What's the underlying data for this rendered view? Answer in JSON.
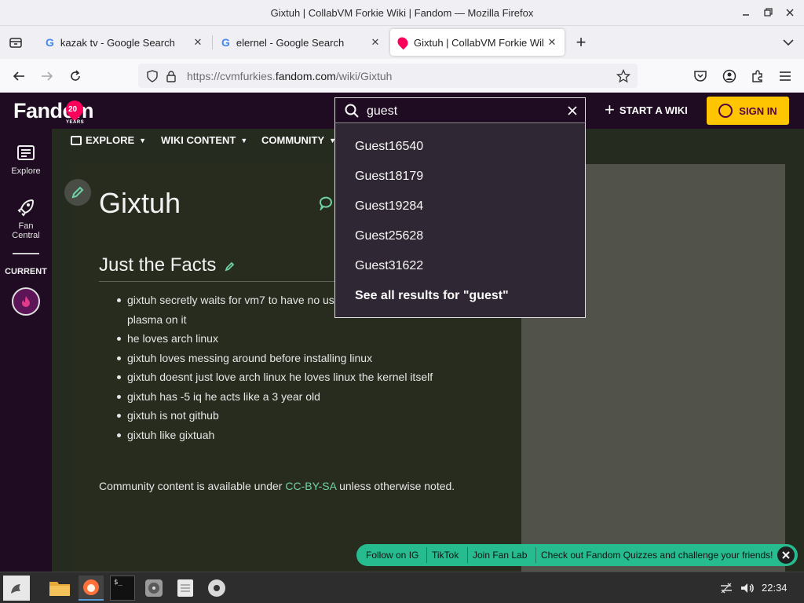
{
  "window": {
    "title": "Gixtuh | CollabVM Forkie Wiki | Fandom — Mozilla Firefox"
  },
  "tabs": [
    {
      "label": "kazak tv - Google Search"
    },
    {
      "label": "elernel - Google Search"
    },
    {
      "label": "Gixtuh | CollabVM Forkie Wiki | Fandom"
    }
  ],
  "url": {
    "prefix": "https://cvmfurkies.",
    "domain": "fandom.com",
    "path": "/wiki/Gixtuh"
  },
  "fandom": {
    "logo": "Fandom",
    "anniversary": "20",
    "years": "YEARS",
    "start_wiki": "START A WIKI",
    "sign_in": "SIGN IN"
  },
  "rail": {
    "explore": "Explore",
    "fan_central_1": "Fan",
    "fan_central_2": "Central",
    "current": "CURRENT"
  },
  "localnav": {
    "explore": "EXPLORE",
    "wiki_content": "WIKI CONTENT",
    "community": "COMMUNITY"
  },
  "search": {
    "query": "guest",
    "results": [
      "Guest16540",
      "Guest18179",
      "Guest19284",
      "Guest25628",
      "Guest31622"
    ],
    "see_all": "See all results for \"guest\""
  },
  "article": {
    "title": "Gixtuh",
    "section": "Just the Facts",
    "facts": [
      "gixtuh secretly waits for vm7 to have no us",
      "plasma on it",
      "he loves arch linux",
      "gixtuh loves messing around before installing linux",
      "gixtuh doesnt just love arch linux he loves linux the kernel itself",
      "gixtuh has -5 iq he acts like a 3 year old",
      "gixtuh is not github",
      "gixtuh like gixtuah"
    ],
    "license_pre": "Community content is available under ",
    "license_link": "CC-BY-SA",
    "license_post": " unless otherwise noted."
  },
  "social": {
    "ig": "Follow on IG",
    "tiktok": "TikTok",
    "fanlab": "Join Fan Lab",
    "quizzes": "Check out Fandom Quizzes and challenge your friends!"
  },
  "taskbar": {
    "clock": "22:34"
  },
  "colors": {
    "fandom_bg": "#1f0c22",
    "signin": "#ffc500",
    "social": "#27bc90",
    "link": "#6fd3a5"
  }
}
